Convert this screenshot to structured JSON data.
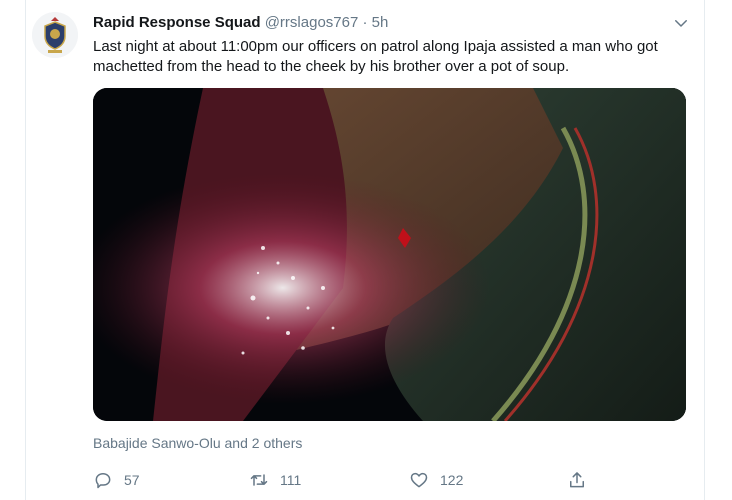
{
  "tweet": {
    "author_name": "Rapid Response Squad",
    "handle": "@rrslagos767",
    "separator": "·",
    "time": "5h",
    "text": "Last night at about 11:00pm our officers on patrol along Ipaja assisted a man who got machetted from the head to the cheek by his brother over a pot of soup.",
    "tagged": "Babajide Sanwo-Olu and 2 others"
  },
  "actions": {
    "replies": "57",
    "retweets": "111",
    "likes": "122"
  },
  "icons": {
    "reply": "reply-icon",
    "retweet": "retweet-icon",
    "like": "like-icon",
    "share": "share-icon",
    "more": "chevron-down-icon"
  },
  "colors": {
    "text": "#14171a",
    "muted": "#657786",
    "border": "#e6ecf0"
  }
}
